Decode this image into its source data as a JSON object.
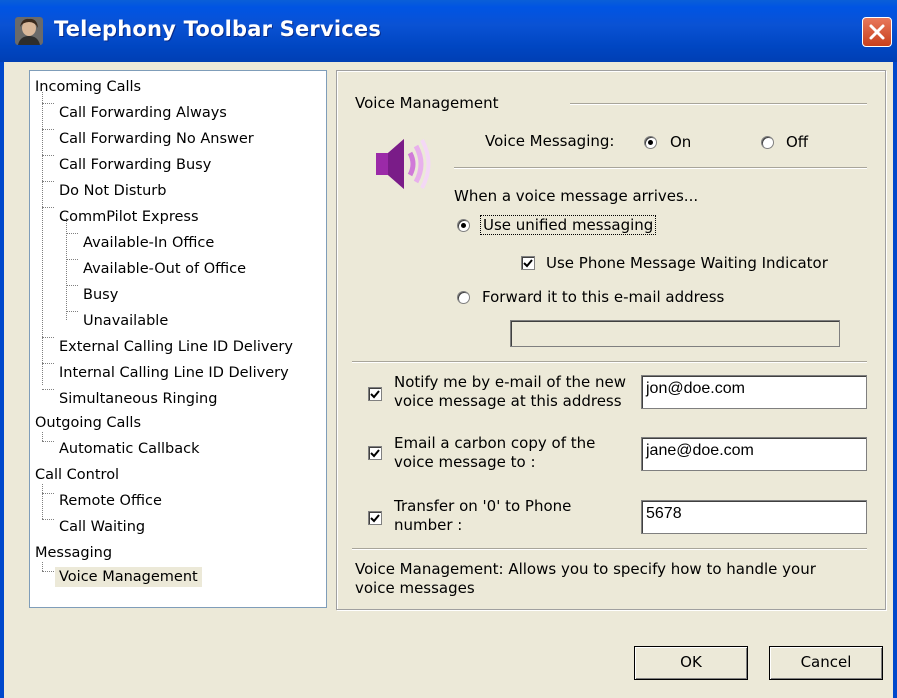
{
  "window": {
    "title": "Telephony Toolbar Services",
    "icon": "app-user-icon",
    "close_icon": "close-icon"
  },
  "tree": {
    "groups": [
      {
        "label": "Incoming Calls",
        "items": [
          {
            "label": "Call Forwarding Always"
          },
          {
            "label": "Call Forwarding No Answer"
          },
          {
            "label": "Call Forwarding Busy"
          },
          {
            "label": "Do Not Disturb"
          },
          {
            "label": "CommPilot Express",
            "children": [
              "Available-In Office",
              "Available-Out of Office",
              "Busy",
              "Unavailable"
            ]
          },
          {
            "label": "External Calling Line ID Delivery"
          },
          {
            "label": "Internal Calling Line ID Delivery"
          },
          {
            "label": "Simultaneous Ringing"
          }
        ]
      },
      {
        "label": "Outgoing Calls",
        "items": [
          {
            "label": "Automatic Callback"
          }
        ]
      },
      {
        "label": "Call Control",
        "items": [
          {
            "label": "Remote Office"
          },
          {
            "label": "Call Waiting"
          }
        ]
      },
      {
        "label": "Messaging",
        "items": [
          {
            "label": "Voice Management",
            "selected": true
          }
        ]
      }
    ]
  },
  "panel": {
    "section_title": "Voice Management",
    "speaker_icon": "speaker-icon",
    "voice_messaging": {
      "label": "Voice Messaging:",
      "on_label": "On",
      "off_label": "Off",
      "selected": "On"
    },
    "arrival_heading": "When a voice message arrives...",
    "unified_label": "Use unified messaging",
    "unified_selected": true,
    "mwi_label": "Use Phone Message Waiting Indicator",
    "mwi_checked": true,
    "forward_label": "Forward it to this e-mail address",
    "forward_selected": false,
    "forward_value": "",
    "notify": {
      "line1": "Notify me by e-mail of the new",
      "line2": "voice message at this address",
      "checked": true,
      "value": "jon@doe.com"
    },
    "carbon_copy": {
      "line1": "Email a carbon copy of the",
      "line2": "voice message to :",
      "checked": true,
      "value": "jane@doe.com"
    },
    "transfer": {
      "line1": "Transfer on '0' to Phone",
      "line2": "number :",
      "checked": true,
      "value": "5678"
    },
    "description_line1": "Voice Management: Allows you to specify how to handle your",
    "description_line2": "voice messages"
  },
  "buttons": {
    "ok_label": "OK",
    "cancel_label": "Cancel"
  },
  "colors": {
    "title_bar": "#0054e3",
    "dialog_bg": "#ece9d8",
    "selected_item_bg": "#ece9d8"
  }
}
